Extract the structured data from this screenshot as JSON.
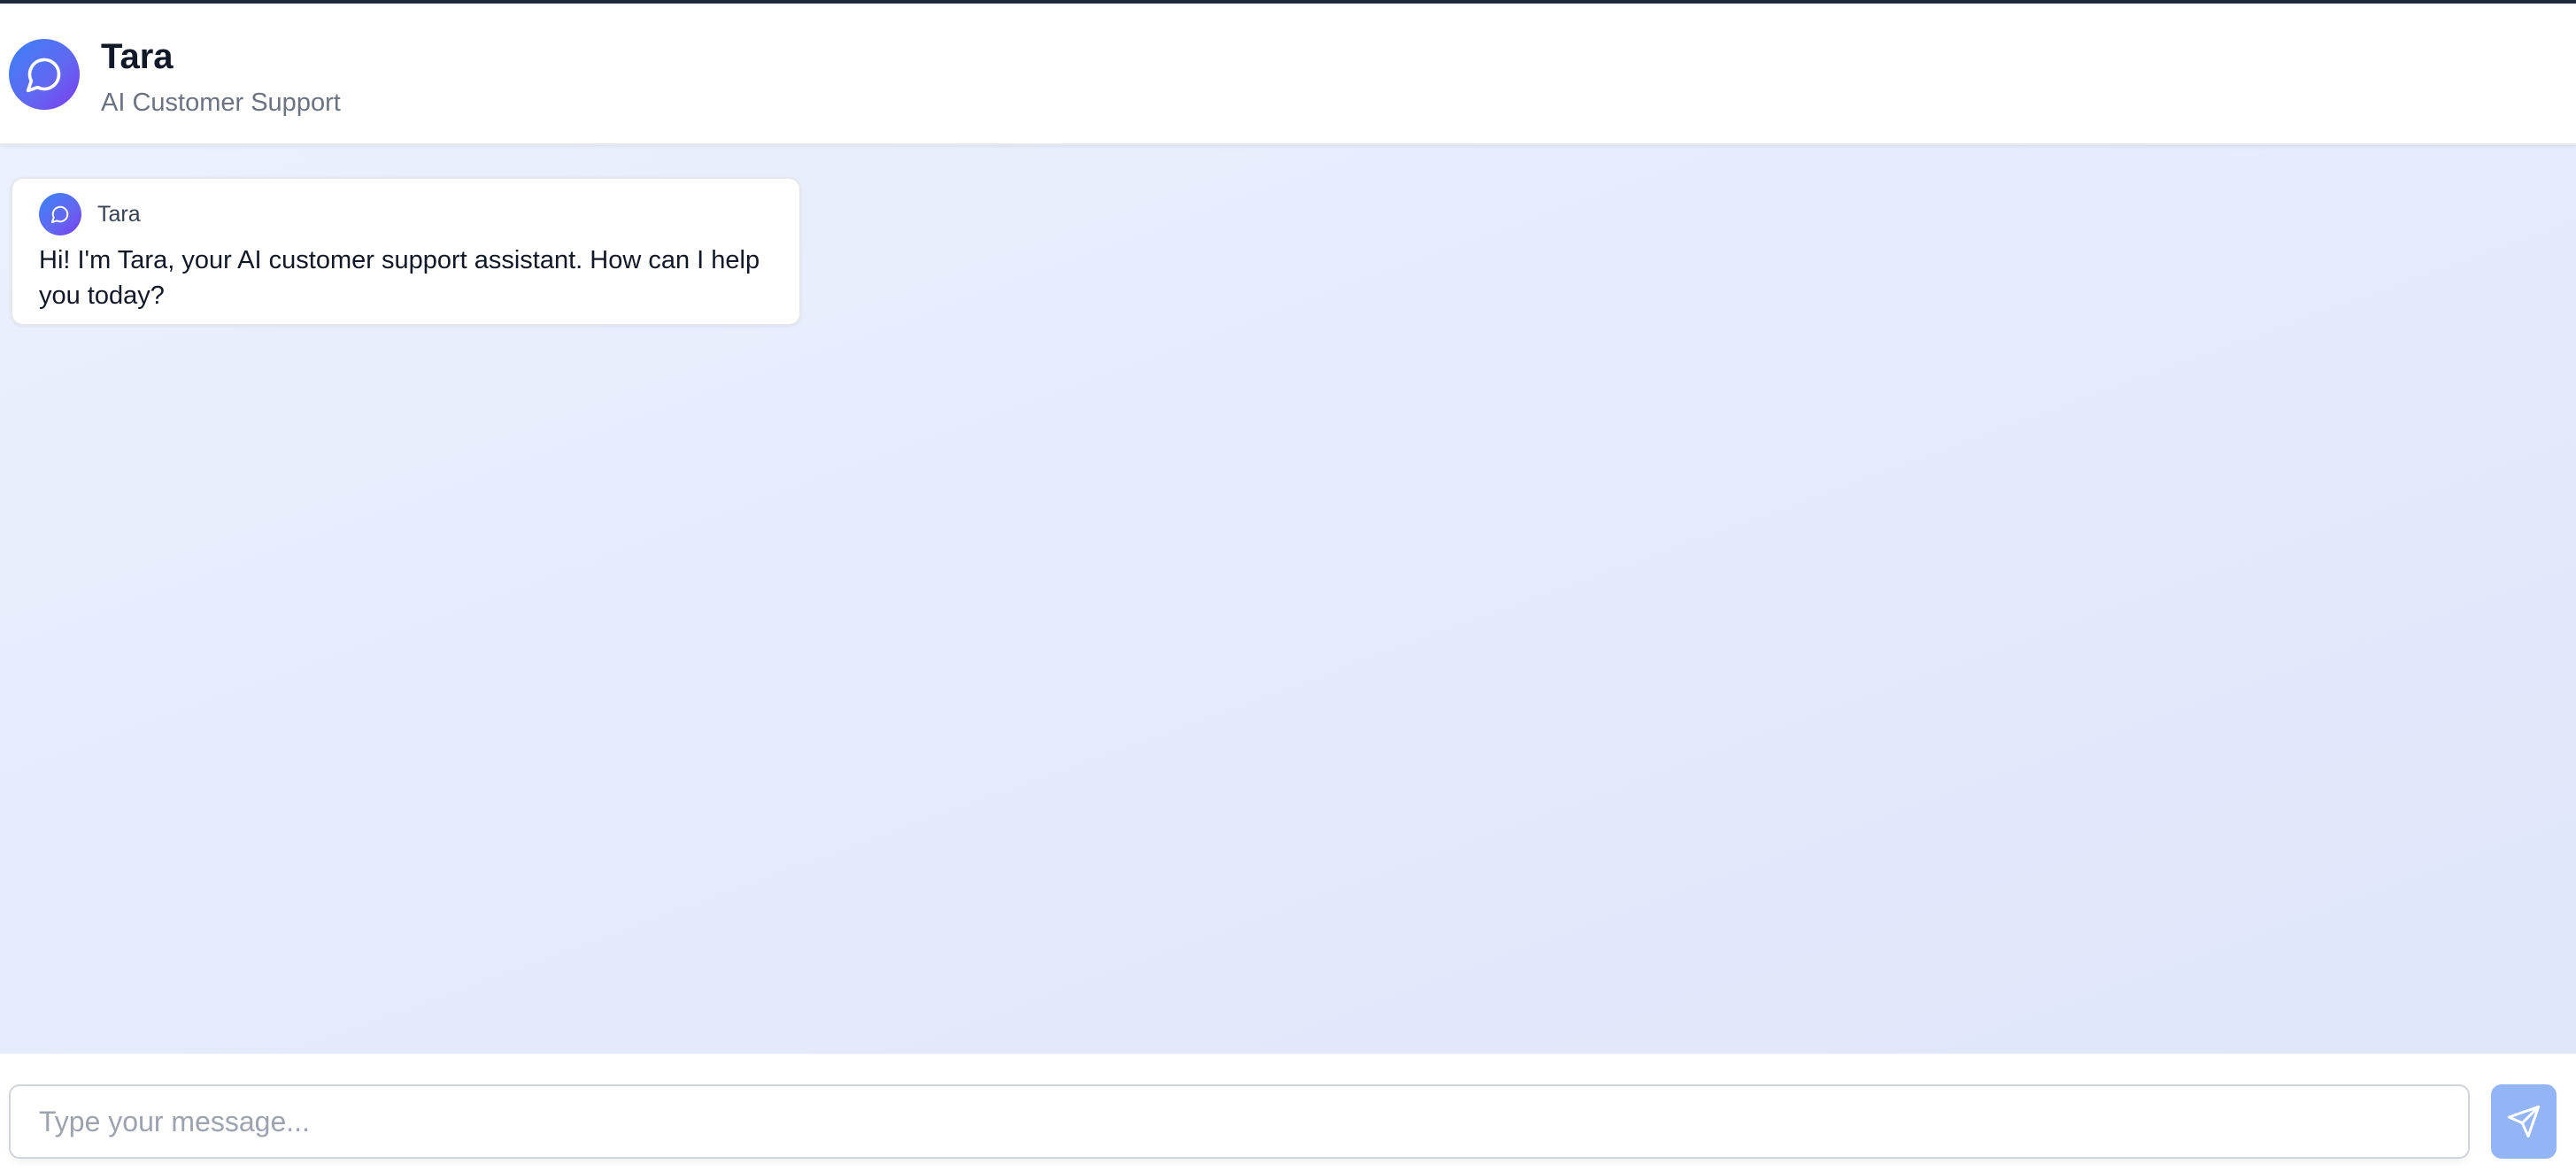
{
  "header": {
    "title": "Tara",
    "subtitle": "AI Customer Support",
    "avatar_icon": "chat-bubble-icon"
  },
  "messages": [
    {
      "sender": "Tara",
      "avatar_icon": "chat-bubble-icon",
      "text": "Hi! I'm Tara, your AI customer support assistant. How can I help you today?"
    }
  ],
  "composer": {
    "placeholder": "Type your message...",
    "value": "",
    "send_icon": "send-icon"
  },
  "colors": {
    "accent_gradient_start": "#3b82f6",
    "accent_gradient_end": "#7c3aed",
    "chat_background": "#e6ecfb",
    "send_button": "#93b4f5",
    "top_strip": "#1e293b"
  }
}
